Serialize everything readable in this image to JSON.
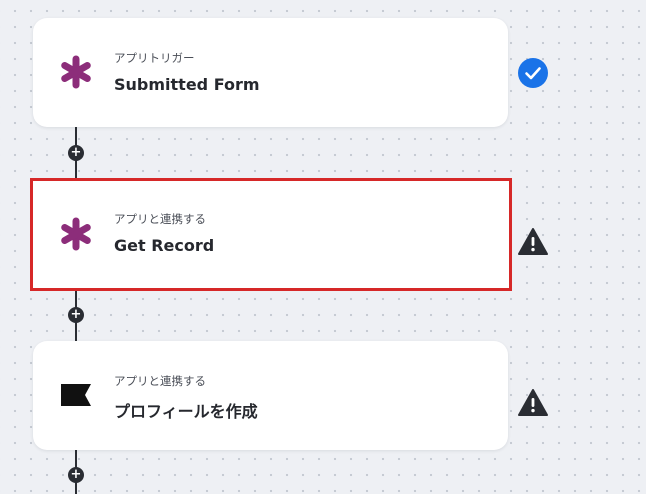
{
  "workflow": {
    "steps": [
      {
        "subtitle": "アプリトリガー",
        "title": "Submitted Form",
        "icon": "asterisk-logo-icon",
        "status": "check-circle-icon",
        "selected": false
      },
      {
        "subtitle": "アプリと連携する",
        "title": "Get Record",
        "icon": "asterisk-logo-icon",
        "status": "warning-triangle-icon",
        "selected": true
      },
      {
        "subtitle": "アプリと連携する",
        "title": "プロフィールを作成",
        "icon": "flag-logo-icon",
        "status": "warning-triangle-icon",
        "selected": false
      }
    ],
    "add_step_symbol": "+"
  },
  "colors": {
    "brand_asterisk": "#8c2d7a",
    "check_blue": "#1a73e8",
    "warning_dark": "#2a2d33",
    "selected_outline": "#d62828",
    "connector": "#2a2d33"
  }
}
